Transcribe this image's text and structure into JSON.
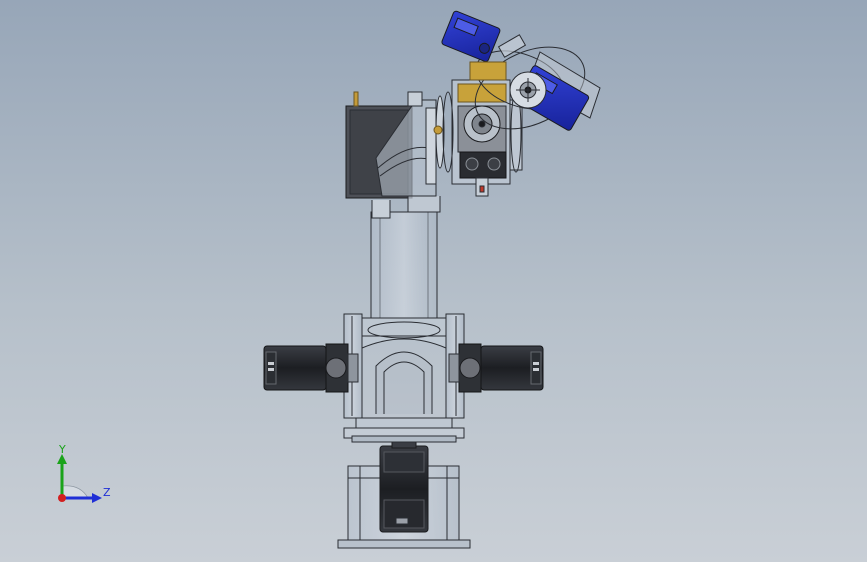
{
  "viewport": {
    "background_top": "#97a6b8",
    "background_bottom": "#c9cfd6"
  },
  "triad": {
    "y_label": "Y",
    "z_label": "Z",
    "y_color": "#1aa31a",
    "z_color": "#1f2fd6",
    "x_color": "#d21f1f"
  },
  "model": {
    "line_color": "#2a2d33",
    "servo_body_color": "#202226",
    "servo_body_dark": "#2d3036",
    "housing_color": "#4d5057",
    "blue_servo_color": "#2030b8",
    "pcb_color": "#c8a23a",
    "glass_color": "#a9b6c6"
  }
}
